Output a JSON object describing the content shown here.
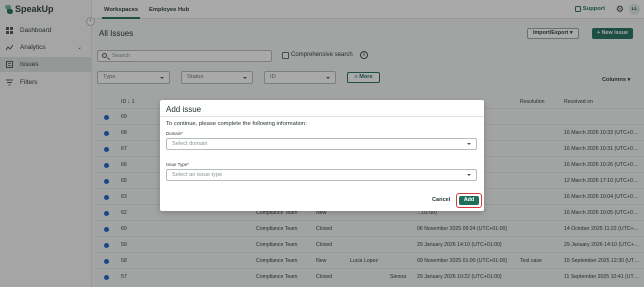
{
  "app": {
    "name": "SpeakUp"
  },
  "sidebar": {
    "collapse_glyph": "‹",
    "items": [
      {
        "label": "Dashboard",
        "icon": "grid-icon"
      },
      {
        "label": "Analytics",
        "icon": "chart-icon",
        "chevron": "⌄"
      },
      {
        "label": "Issues",
        "icon": "issues-icon",
        "active": true
      },
      {
        "label": "Filters",
        "icon": "filter-icon"
      }
    ]
  },
  "topbar": {
    "tabs": [
      "Workspaces",
      "Employee Hub"
    ],
    "support_label": "Support",
    "avatar_initials": "LL"
  },
  "main": {
    "title": "All Issues",
    "import_export_label": "Import/Export",
    "new_issue_label": "+ New issue",
    "search_placeholder": "Search",
    "comprehensive_label": "Comprehensive search",
    "filters": [
      "Type",
      "Status",
      "ID"
    ],
    "more_label": "More",
    "columns_label": "Columns"
  },
  "table": {
    "headers": {
      "id": "ID",
      "resolution": "Resolution",
      "received": "Received on"
    },
    "sort_badge": "1",
    "rows": [
      {
        "id": "69",
        "team": "",
        "status": "",
        "assignee": "",
        "extra": "",
        "date": "…01:00)",
        "resolution": "",
        "received": ""
      },
      {
        "id": "68",
        "team": "",
        "status": "",
        "assignee": "",
        "extra": "",
        "date": "…01:00)",
        "resolution": "",
        "received": "16 March 2026 10:33 (UTC+0…"
      },
      {
        "id": "67",
        "team": "",
        "status": "",
        "assignee": "",
        "extra": "",
        "date": "…01:00)",
        "resolution": "",
        "received": "16 March 2026 10:31 (UTC+0…"
      },
      {
        "id": "66",
        "team": "",
        "status": "",
        "assignee": "",
        "extra": "",
        "date": "…01:00)",
        "resolution": "",
        "received": "16 March 2026 10:26 (UTC+0…"
      },
      {
        "id": "65",
        "team": "",
        "status": "",
        "assignee": "",
        "extra": "",
        "date": "…01:00)",
        "resolution": "",
        "received": "12 March 2026 17:10 (UTC+0…"
      },
      {
        "id": "63",
        "team": "",
        "status": "",
        "assignee": "",
        "extra": "",
        "date": "…01:00)",
        "resolution": "",
        "received": "16 March 2026 10:04 (UTC+0…"
      },
      {
        "id": "62",
        "team": "Compliance Team",
        "status": "New",
        "assignee": "",
        "extra": "",
        "date": "…01:00)",
        "resolution": "",
        "received": "16 March 2026 10:05 (UTC+0…"
      },
      {
        "id": "60",
        "team": "Compliance Team",
        "status": "Closed",
        "assignee": "",
        "extra": "",
        "date": "06 November 2025 09:24 (UTC+01:00)",
        "resolution": "",
        "received": "14 October 2025 11:22 (UTC+…"
      },
      {
        "id": "59",
        "team": "Compliance Team",
        "status": "Closed",
        "assignee": "",
        "extra": "",
        "date": "29 January 2026 14:10 (UTC+01:00)",
        "resolution": "",
        "received": "29 January 2026 14:10 (UTC+…"
      },
      {
        "id": "58",
        "team": "Compliance Team",
        "status": "New",
        "assignee": "Lucia Lopez",
        "extra": "",
        "date": "09 November 2025 01:00 (UTC+01:00)",
        "resolution": "Test case",
        "received": "15 September 2025 12:30 (UT…"
      },
      {
        "id": "57",
        "team": "Compliance Team",
        "status": "Closed",
        "assignee": "",
        "extra": "Sienna",
        "date": "29 January 2026 10:22 (UTC+01:00)",
        "resolution": "",
        "received": "11 September 2025 10:41 (UT…"
      }
    ]
  },
  "modal": {
    "title": "Add issue",
    "instruction": "To continue, please complete the following information:",
    "domain_label": "Domain*",
    "domain_placeholder": "Select domain",
    "type_label": "Issue Type*",
    "type_placeholder": "Select an issue type",
    "cancel_label": "Cancel",
    "add_label": "Add"
  },
  "colors": {
    "brand": "#1f6f5c",
    "highlight": "#d23b3b",
    "status_dot": "#1d5fc9"
  }
}
